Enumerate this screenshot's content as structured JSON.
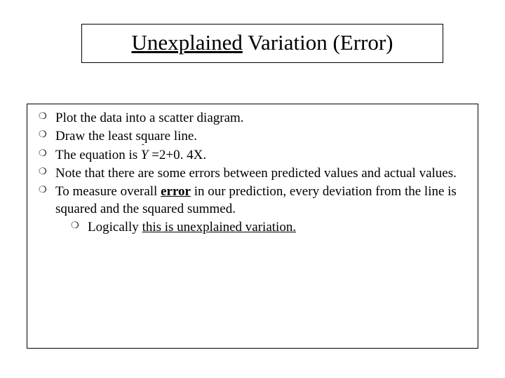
{
  "title": {
    "underlined": "Unexplained",
    "rest": " Variation (Error)"
  },
  "bullets": {
    "b1": "Plot the data into a scatter diagram.",
    "b2": "Draw the least square line.",
    "b3_prefix": "The equation is ",
    "b3_yhat_letter": "Y",
    "b3_yhat_hat": "ˆ",
    "b3_suffix": " =2+0. 4X.",
    "b4": "Note that there are some errors between predicted values and actual values.",
    "b5_prefix": "To measure overall ",
    "b5_error": "error",
    "b5_suffix": " in our prediction, every deviation from the line is squared and the squared summed.",
    "sub_prefix": "Logically ",
    "sub_underlined": "this is unexplained variation."
  }
}
